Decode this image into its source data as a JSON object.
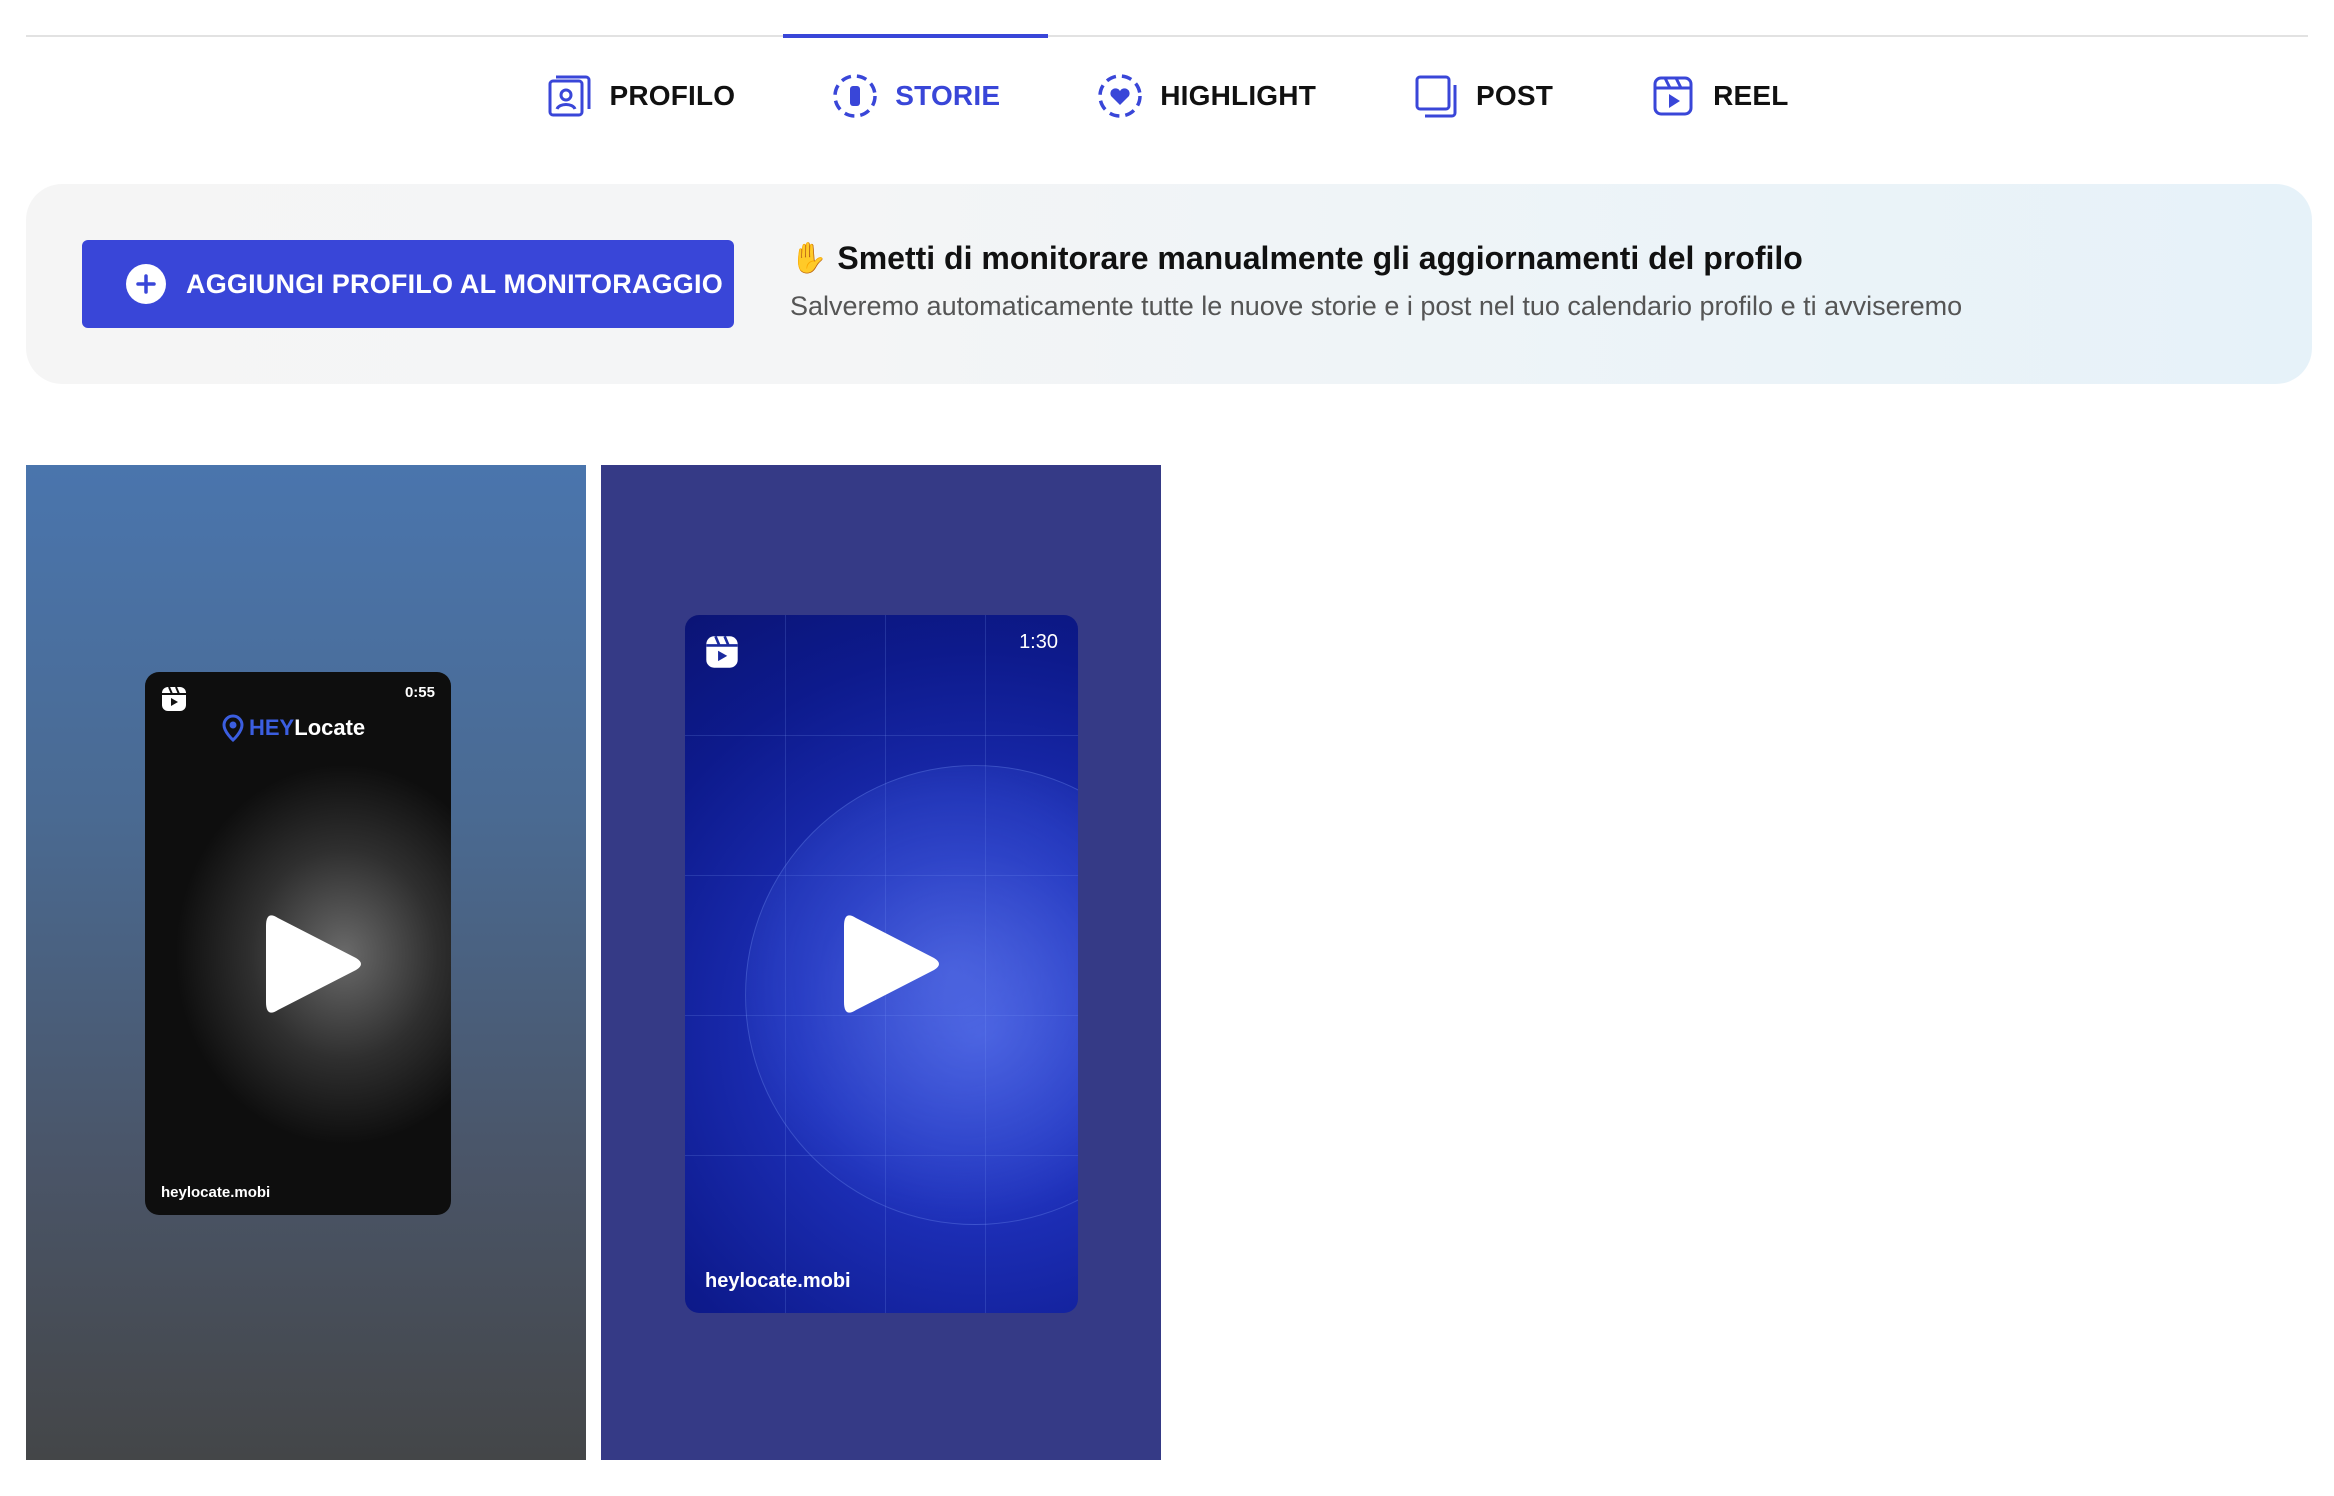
{
  "tabs": [
    {
      "label": "PROFILO",
      "icon": "profile-icon",
      "active": false
    },
    {
      "label": "STORIE",
      "icon": "story-icon",
      "active": true
    },
    {
      "label": "HIGHLIGHT",
      "icon": "highlight-heart-icon",
      "active": false
    },
    {
      "label": "POST",
      "icon": "post-icon",
      "active": false
    },
    {
      "label": "REEL",
      "icon": "reel-icon",
      "active": false
    }
  ],
  "banner": {
    "button_label": "AGGIUNGI PROFILO AL MONITORAGGIO",
    "emoji": "✋",
    "title": "Smetti di monitorare manualmente gli aggiornamenti del profilo",
    "subtitle": "Salveremo automaticamente tutte le nuove storie e i post nel tuo calendario profilo e ti avviseremo"
  },
  "stories": [
    {
      "duration": "0:55",
      "caption": "heylocate.mobi",
      "brand_hey": "HEY",
      "brand_locate": "Locate"
    },
    {
      "duration": "1:30",
      "caption": "heylocate.mobi"
    }
  ],
  "colors": {
    "accent": "#3946d8",
    "card1_top": "#4a75ad",
    "card2_bg": "#353a86"
  }
}
